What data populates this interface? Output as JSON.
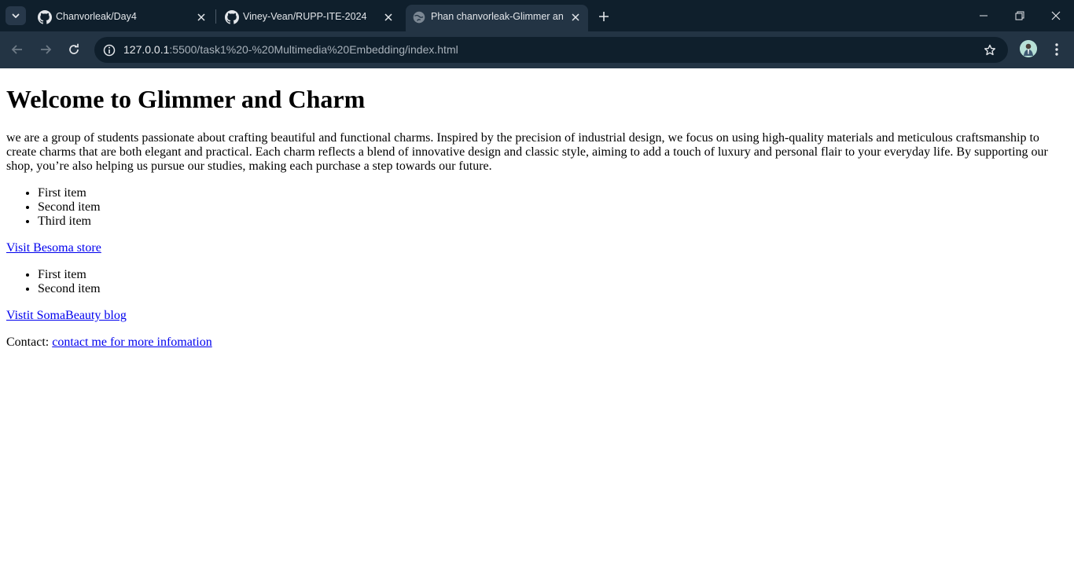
{
  "browser": {
    "tabs": [
      {
        "title": "Chanvorleak/Day4",
        "icon": "github-icon"
      },
      {
        "title": "Viney-Vean/RUPP-ITE-2024",
        "icon": "github-icon"
      },
      {
        "title": "Phan chanvorleak-Glimmer and",
        "icon": "globe-icon",
        "active": true
      }
    ],
    "url_host": "127.0.0.1",
    "url_path": ":5500/task1%20-%20Multimedia%20Embedding/index.html",
    "colors": {
      "tab_strip": "#0f1f2c",
      "toolbar": "#233444",
      "link": "#0000ee"
    }
  },
  "page": {
    "heading": "Welcome to Glimmer and Charm",
    "intro": "we are a group of students passionate about crafting beautiful and functional charms. Inspired by the precision of industrial design, we focus on using high-quality materials and meticulous craftsmanship to create charms that are both elegant and practical. Each charm reflects a blend of innovative design and classic style, aiming to add a touch of luxury and personal flair to your everyday life. By supporting our shop, you’re also helping us pursue our studies, making each purchase a step towards our future.",
    "list1": [
      "First item",
      "Second item",
      "Third item"
    ],
    "link1": "Visit Besoma store",
    "list2": [
      "First item",
      "Second item"
    ],
    "link2": "Vistit SomaBeauty blog",
    "contact_label": "Contact: ",
    "contact_link": "contact me for more infomation"
  }
}
